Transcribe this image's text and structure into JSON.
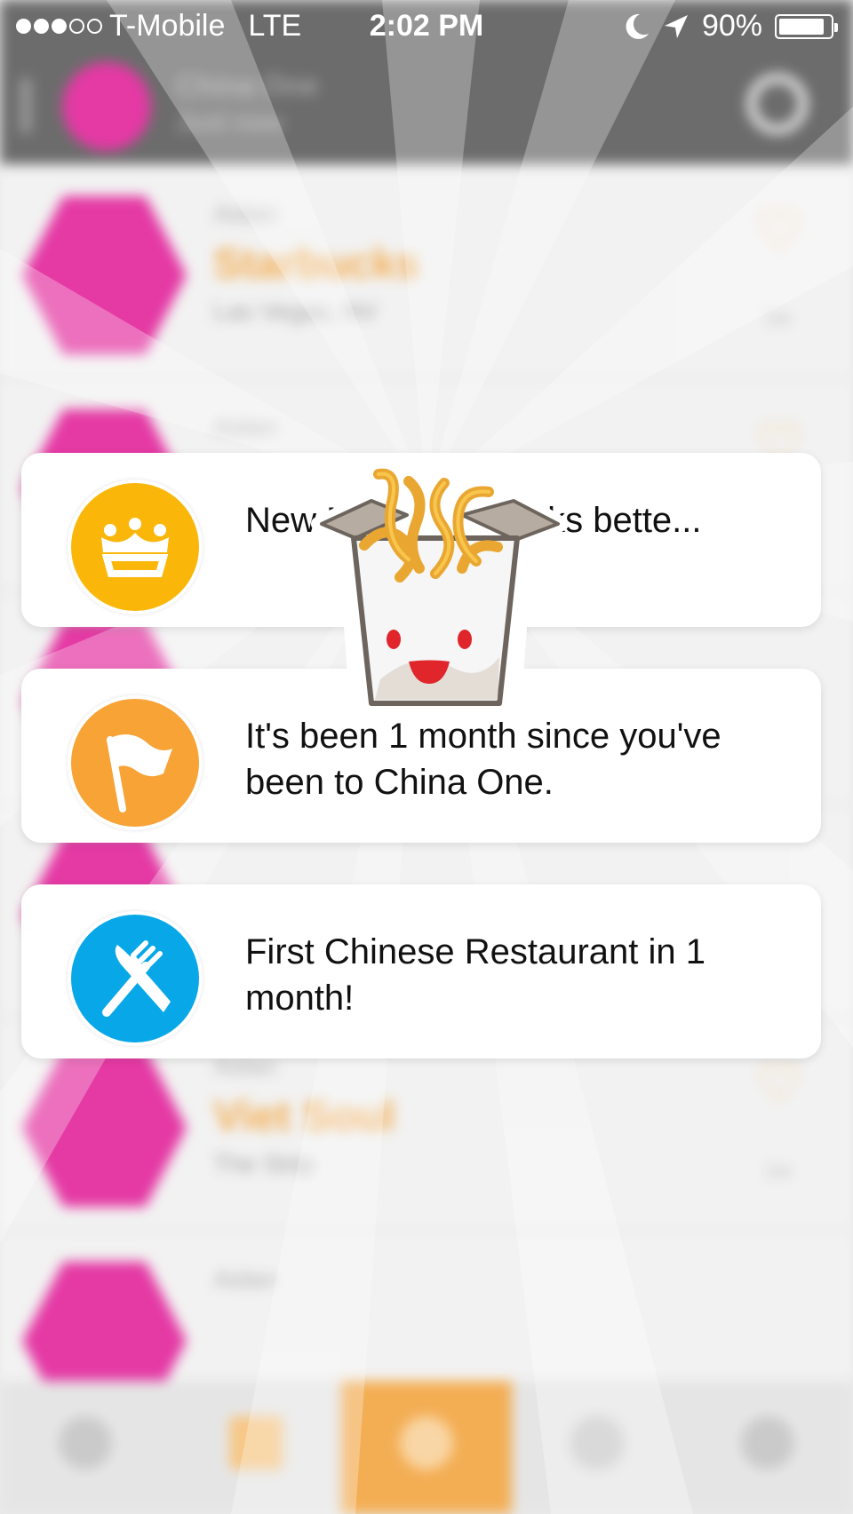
{
  "status_bar": {
    "carrier": "T-Mobile",
    "network": "LTE",
    "time": "2:02 PM",
    "battery": "90%",
    "battery_level": 0.9,
    "signal_bars": 3,
    "signal_total": 5
  },
  "background": {
    "header": {
      "title": "China One",
      "subtitle": "Just now"
    },
    "feed": [
      {
        "who": "Aidan",
        "place": "Starbucks",
        "city": "Las Vegas, NV",
        "ago": "1w"
      },
      {
        "who": "Aidan",
        "place": "",
        "city": "",
        "ago": ""
      },
      {
        "who": "Aidan",
        "place": "Viet Soul",
        "city": "The Strip",
        "ago": "1w"
      },
      {
        "who": "Aidan",
        "place": "",
        "city": "",
        "ago": ""
      }
    ]
  },
  "notifications": [
    {
      "icon": "crown-icon",
      "color": "#fab70a",
      "text": "New M... crown looks bette..."
    },
    {
      "icon": "flag-icon",
      "color": "#f7a336",
      "text": "It's been 1 month since you've been to China One."
    },
    {
      "icon": "fork-knife-icon",
      "color": "#08a7e7",
      "text": "First Chinese Restaurant in 1 month!"
    }
  ],
  "colors": {
    "accent": "#f2a541",
    "avatar": "#e2239a"
  }
}
